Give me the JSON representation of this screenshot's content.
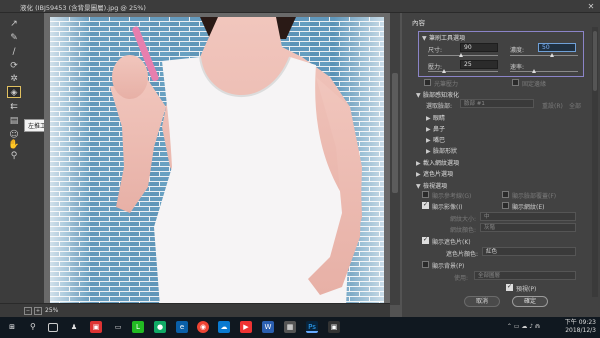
{
  "window": {
    "title": "液化 (IBJ59453 (含背景圖層).jpg @ 25%)",
    "close_glyph": "✕"
  },
  "tools": {
    "tooltip": "左推工具 (O)"
  },
  "status": {
    "zoom": "25%"
  },
  "panel": {
    "title": "內容",
    "brush_tool_options": "筆刷工具選項",
    "size_label": "尺寸:",
    "size_value": "90",
    "density_label": "濃度:",
    "density_value": "50",
    "pressure_label": "壓力:",
    "pressure_value": "25",
    "rate_label": "速率:",
    "stylus_pressure": "光筆壓力",
    "pin_edges": "固定邊緣",
    "face_aware": "臉部感知液化",
    "select_face_label": "選取臉部:",
    "select_face_value": "臉部 #1",
    "reset_label": "重設(R)",
    "all_label": "全部",
    "eyes": "眼睛",
    "nose": "鼻子",
    "mouth": "嘴巴",
    "face_shape": "臉部形狀",
    "load_mesh": "載入網紋選項",
    "mask_options": "遮色片選項",
    "view_options": "檢視選項",
    "show_guides": "顯示參考線(G)",
    "show_face_overlay": "顯示臉部覆蓋(F)",
    "show_image": "顯示影像(I)",
    "show_mesh": "顯示網紋(E)",
    "mesh_size_label": "網紋大小:",
    "mesh_size_value": "中",
    "mesh_color_label": "網紋顏色:",
    "mesh_color_value": "灰階",
    "show_mask": "顯示遮色片(K)",
    "mask_color_label": "遮色片顏色:",
    "mask_color_value": "紅色",
    "show_backdrop": "顯示背景(P)",
    "use_label": "使用:",
    "use_value": "全部圖層",
    "preview": "預視(P)",
    "cancel": "取消",
    "ok": "確定"
  },
  "taskbar": {
    "time": "下午 09:23",
    "date": "2018/12/3"
  }
}
